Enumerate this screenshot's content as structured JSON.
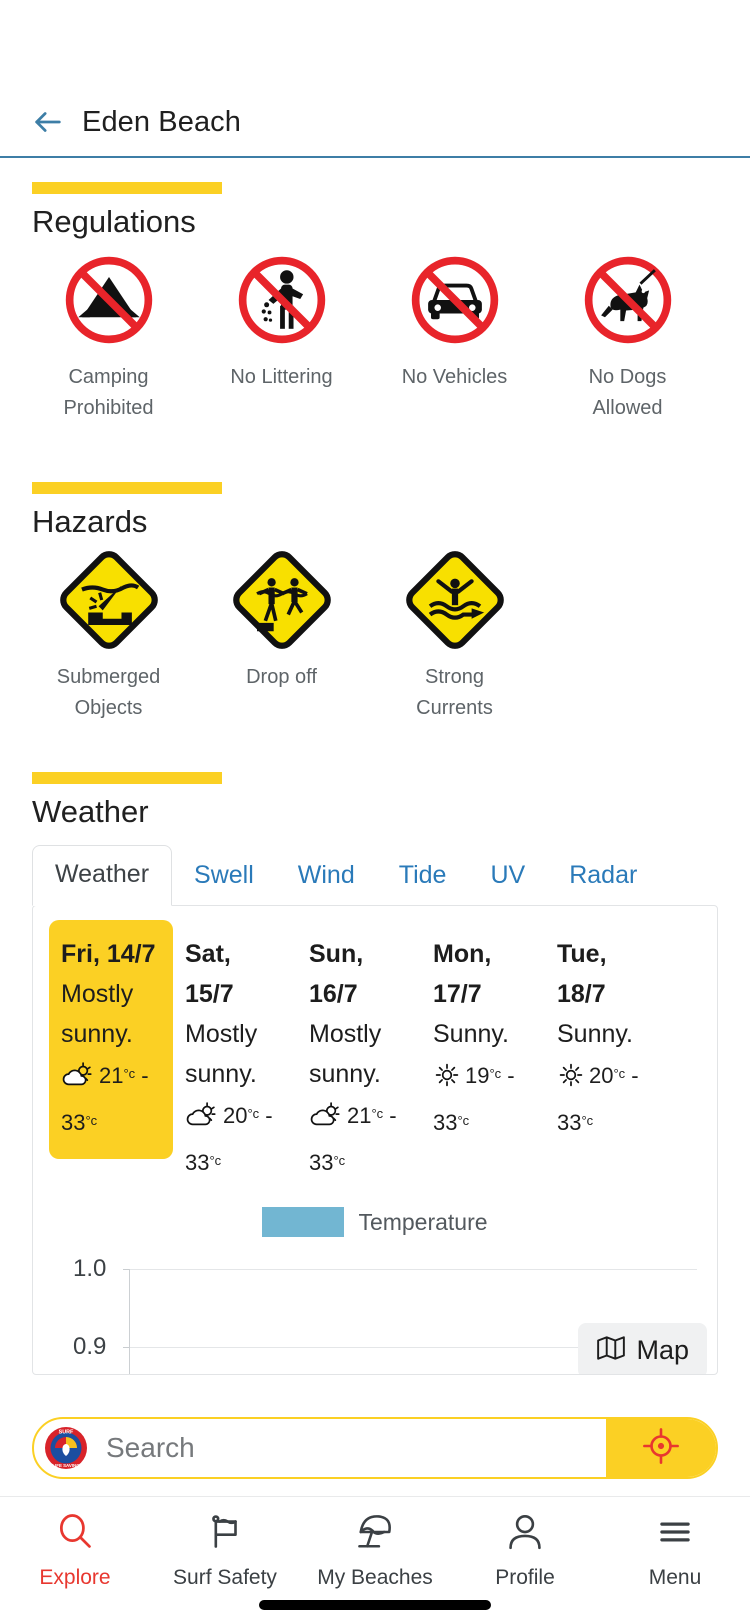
{
  "appbar": {
    "back_icon": "back-arrow-icon",
    "title": "Eden Beach"
  },
  "sections": {
    "regulations": {
      "title": "Regulations",
      "items": [
        {
          "icon": "no-camping-icon",
          "label": "Camping Prohibited"
        },
        {
          "icon": "no-littering-icon",
          "label": "No Littering"
        },
        {
          "icon": "no-vehicles-icon",
          "label": "No Vehicles"
        },
        {
          "icon": "no-dogs-icon",
          "label": "No Dogs Allowed"
        }
      ]
    },
    "hazards": {
      "title": "Hazards",
      "items": [
        {
          "icon": "submerged-objects-icon",
          "label": "Submerged Objects"
        },
        {
          "icon": "drop-off-icon",
          "label": "Drop off"
        },
        {
          "icon": "strong-currents-icon",
          "label": "Strong Currents"
        }
      ]
    },
    "weather": {
      "title": "Weather",
      "tabs": [
        {
          "label": "Weather",
          "active": true
        },
        {
          "label": "Swell",
          "active": false
        },
        {
          "label": "Wind",
          "active": false
        },
        {
          "label": "Tide",
          "active": false
        },
        {
          "label": "UV",
          "active": false
        },
        {
          "label": "Radar",
          "active": false
        }
      ],
      "forecast": [
        {
          "day": "Fri, 14/7",
          "desc": "Mostly sunny.",
          "icon": "partly-sunny-icon",
          "min": "21",
          "max": "33",
          "unit": "°c",
          "today": true
        },
        {
          "day": "Sat, 15/7",
          "desc": "Mostly sunny.",
          "icon": "partly-sunny-icon",
          "min": "20",
          "max": "33",
          "unit": "°c",
          "today": false
        },
        {
          "day": "Sun, 16/7",
          "desc": "Mostly sunny.",
          "icon": "partly-sunny-icon",
          "min": "21",
          "max": "33",
          "unit": "°c",
          "today": false
        },
        {
          "day": "Mon, 17/7",
          "desc": "Sunny.",
          "icon": "sunny-icon",
          "min": "19",
          "max": "33",
          "unit": "°c",
          "today": false
        },
        {
          "day": "Tue, 18/7",
          "desc": "Sunny.",
          "icon": "sunny-icon",
          "min": "20",
          "max": "33",
          "unit": "°c",
          "today": false
        }
      ],
      "map_button": {
        "label": "Map",
        "icon": "map-icon"
      }
    }
  },
  "chart_data": {
    "type": "bar",
    "title": "",
    "legend": [
      {
        "name": "Temperature",
        "color": "#72b6d2"
      }
    ],
    "legend_position": "top-center",
    "categories": [],
    "values": [],
    "ylim": [
      0.9,
      1.0
    ],
    "yticks": [
      "1.0",
      "0.9"
    ],
    "xlabel": "",
    "ylabel": "",
    "grid": true
  },
  "search": {
    "placeholder": "Search",
    "value": "",
    "logo_icon": "surf-life-saving-logo",
    "geo_icon": "crosshair-locate-icon"
  },
  "bottom_nav": [
    {
      "label": "Explore",
      "icon": "search-icon",
      "active": true
    },
    {
      "label": "Surf Safety",
      "icon": "flag-icon",
      "active": false
    },
    {
      "label": "My Beaches",
      "icon": "beach-umbrella-icon",
      "active": false
    },
    {
      "label": "Profile",
      "icon": "person-icon",
      "active": false
    },
    {
      "label": "Menu",
      "icon": "hamburger-icon",
      "active": false
    }
  ],
  "colors": {
    "accent_yellow": "#fbd024",
    "link_blue": "#2a7ab9",
    "active_red": "#e8372f",
    "prohibition_red": "#e8242a",
    "temperature_blue": "#72b6d2"
  }
}
